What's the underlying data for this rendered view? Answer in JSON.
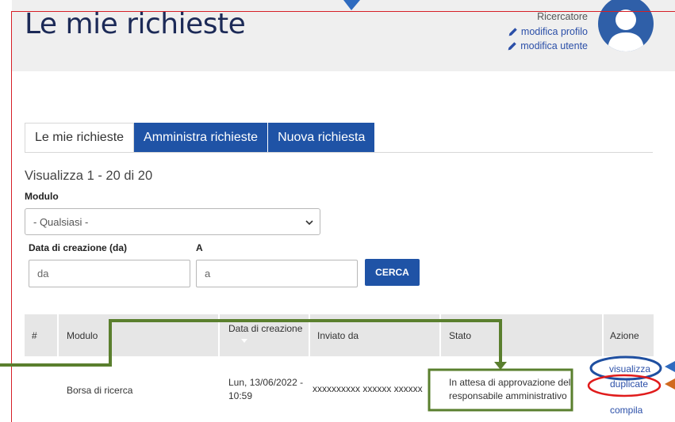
{
  "header": {
    "title": "Le mie richieste",
    "role": "Ricercatore",
    "links": [
      "modifica profilo",
      "modifica utente"
    ]
  },
  "tabs": [
    {
      "label": "Le mie richieste",
      "active": true
    },
    {
      "label": "Amministra richieste",
      "active": false
    },
    {
      "label": "Nuova richiesta",
      "active": false
    }
  ],
  "summary": "Visualizza 1 - 20 di 20",
  "filters": {
    "modulo_label": "Modulo",
    "modulo_value": "- Qualsiasi -",
    "date_from_label": "Data di creazione (da)",
    "date_to_label": "A",
    "date_from_placeholder": "da",
    "date_to_placeholder": "a",
    "search_button": "CERCA"
  },
  "table": {
    "columns": [
      "#",
      "Modulo",
      "Data di creazione",
      "Inviato da",
      "Stato",
      "Azione"
    ],
    "rows": [
      {
        "modulo": "Borsa di ricerca",
        "data_line1": "Lun, 13/06/2022 -",
        "data_line2": "10:59",
        "inviato_da": "xxxxxxxxxx xxxxxx xxxxxx",
        "stato_line1": "In attesa di approvazione del",
        "stato_line2": "responsabile amministrativo",
        "azioni": [
          "visualizza",
          "duplicate",
          "compila"
        ]
      }
    ]
  },
  "colors": {
    "brand_blue": "#1f53a6",
    "title_navy": "#1c2a57",
    "annotation_green": "#5a7f2e",
    "annotation_blue": "#2f6bbf",
    "annotation_red": "#e01b1b",
    "annotation_orange": "#d06a1f",
    "frame_red": "#d61f26"
  }
}
